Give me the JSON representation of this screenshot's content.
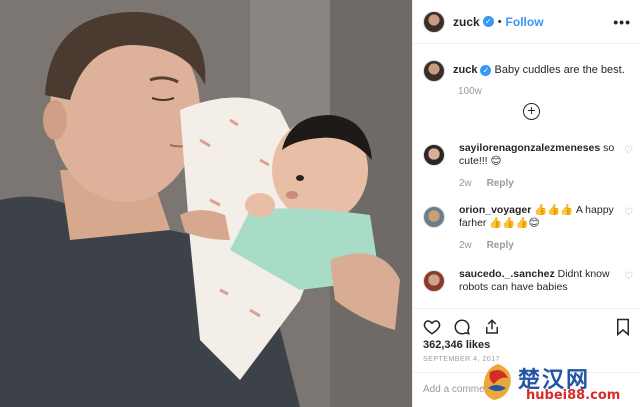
{
  "post": {
    "username": "zuck",
    "follow_label": "Follow",
    "dot": "•",
    "more_label": "•••"
  },
  "caption": {
    "username": "zuck",
    "text": "Baby cuddles are the best.",
    "time": "100w"
  },
  "comments": [
    {
      "username": "sayilorenagonzalezmeneses",
      "text": " so cute!!! 😊",
      "time": "2w",
      "reply": "Reply"
    },
    {
      "username": "orion_voyager",
      "text": " 👍👍👍 A happy farher 👍👍👍😊",
      "time": "2w",
      "reply": "Reply"
    },
    {
      "username": "saucedo._.sanchez",
      "text": " Didnt know robots can have babies",
      "time": "",
      "reply": ""
    }
  ],
  "likes": "362,346 likes",
  "date": "SEPTEMBER 4, 2017",
  "add_comment_placeholder": "Add a comment...",
  "watermark": {
    "title": "楚汉网",
    "url": "hubei88.com"
  },
  "colors": {
    "accent": "#3897f0",
    "muted": "#999999",
    "text": "#262626"
  },
  "icons": [
    "verified-badge-icon",
    "plus-circle-icon",
    "heart-icon",
    "comment-icon",
    "share-icon",
    "bookmark-icon"
  ]
}
